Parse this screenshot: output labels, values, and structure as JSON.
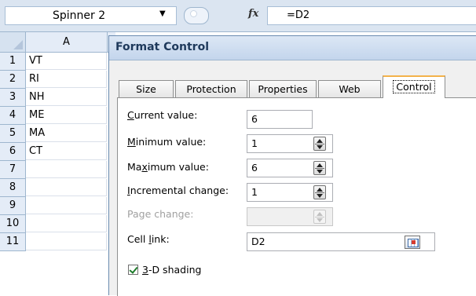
{
  "formula_bar": {
    "name_box": "Spinner 2",
    "fx_label": "fx",
    "formula": "=D2"
  },
  "sheet": {
    "column_header": "A",
    "rows": [
      {
        "num": "1",
        "value": "VT"
      },
      {
        "num": "2",
        "value": "RI"
      },
      {
        "num": "3",
        "value": "NH"
      },
      {
        "num": "4",
        "value": "ME"
      },
      {
        "num": "5",
        "value": "MA"
      },
      {
        "num": "6",
        "value": "CT"
      },
      {
        "num": "7",
        "value": ""
      },
      {
        "num": "8",
        "value": ""
      },
      {
        "num": "9",
        "value": ""
      },
      {
        "num": "10",
        "value": ""
      },
      {
        "num": "11",
        "value": ""
      }
    ]
  },
  "dialog": {
    "title": "Format Control",
    "tabs": [
      "Size",
      "Protection",
      "Properties",
      "Web",
      "Control"
    ],
    "active_tab": "Control",
    "fields": {
      "current_value": {
        "label_pre": "",
        "label_u": "C",
        "label_post": "urrent value:",
        "value": "6"
      },
      "minimum_value": {
        "label_pre": "",
        "label_u": "M",
        "label_post": "inimum value:",
        "value": "1"
      },
      "maximum_value": {
        "label_pre": "Ma",
        "label_u": "x",
        "label_post": "imum value:",
        "value": "6"
      },
      "incremental_change": {
        "label_pre": "",
        "label_u": "I",
        "label_post": "ncremental change:",
        "value": "1"
      },
      "page_change": {
        "label": "Page change:",
        "value": ""
      },
      "cell_link": {
        "label_pre": "Cell ",
        "label_u": "l",
        "label_post": "ink:",
        "value": "D2"
      }
    },
    "shading": {
      "label_u": "3",
      "label_post": "-D shading",
      "checked": true
    }
  },
  "colors": {
    "accent_tab": "#f3b24a",
    "title_text": "#1e395b",
    "header_bg": "#e4ecf7"
  }
}
